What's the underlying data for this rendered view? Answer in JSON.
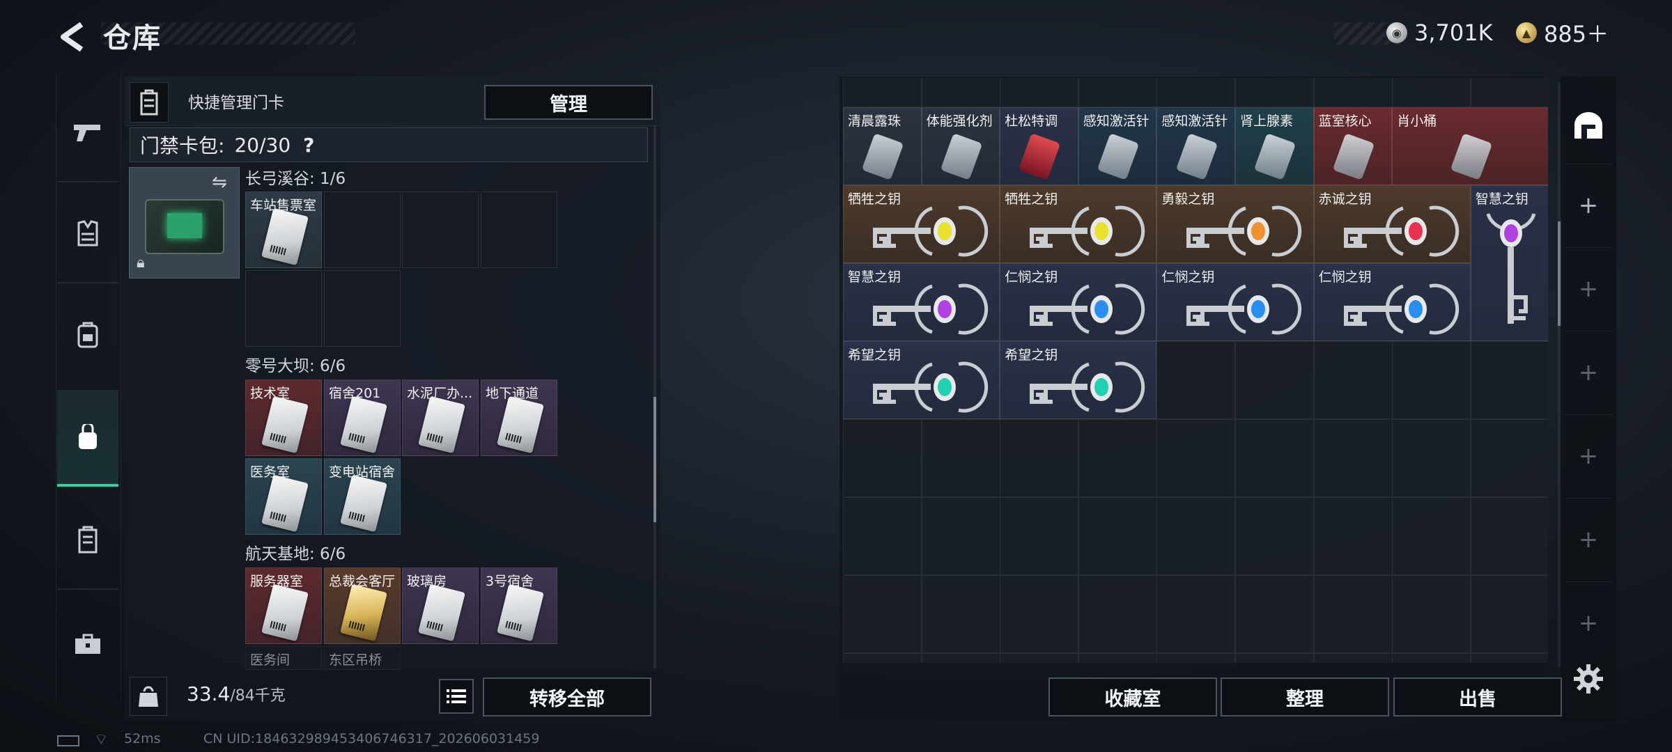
{
  "header": {
    "title": "仓库",
    "currency_1": "3,701K",
    "currency_2": "885＋"
  },
  "left_nav": {
    "items": [
      "weapon-icon",
      "armor-icon",
      "backpack-icon",
      "keycard-case-icon",
      "chest-rig-icon",
      "toolbox-icon"
    ],
    "active_index": 3
  },
  "quick_manage": {
    "label": "快捷管理门卡",
    "manage_button": "管理"
  },
  "access_pack": {
    "label": "门禁卡包:",
    "value": "20/30",
    "help": "?"
  },
  "sections": [
    {
      "title": "长弓溪谷: 1/6",
      "slots": [
        "车站售票室",
        "",
        "",
        "",
        "",
        ""
      ]
    },
    {
      "title": "零号大坝: 6/6",
      "slots": [
        "技术室",
        "宿舍201",
        "水泥厂办...",
        "地下通道",
        "医务室",
        "变电站宿舍"
      ]
    },
    {
      "title": "航天基地: 6/6",
      "slots": [
        "服务器室",
        "总裁会客厅",
        "玻璃房",
        "3号宿舍",
        "医务间",
        "东区吊桥"
      ]
    }
  ],
  "bottom": {
    "weight_value": "33.4",
    "weight_max": "/84千克",
    "transfer_all": "转移全部"
  },
  "status_bar": {
    "ping": "52ms",
    "uid": "CN UID:1846329894534067463​17_202606031459"
  },
  "items_row1": [
    "清晨露珠",
    "体能强化剂",
    "杜松特调",
    "感知激活针",
    "感知激活针",
    "肾上腺素",
    "蓝室核心",
    "肖小桶"
  ],
  "keys": [
    "牺牲之钥",
    "牺牲之钥",
    "勇毅之钥",
    "赤诚之钥",
    "智慧之钥",
    "智慧之钥",
    "仁悯之钥",
    "仁悯之钥",
    "仁悯之钥",
    "希望之钥",
    "希望之钥"
  ],
  "right_buttons": {
    "collection": "收藏室",
    "sort": "整理",
    "sell": "出售"
  },
  "gem_colors": {
    "yellow": "#e8e22a",
    "orange": "#f09030",
    "red": "#e83050",
    "purple": "#b040e0",
    "blue": "#2a8ef0",
    "teal": "#20d0b0"
  }
}
